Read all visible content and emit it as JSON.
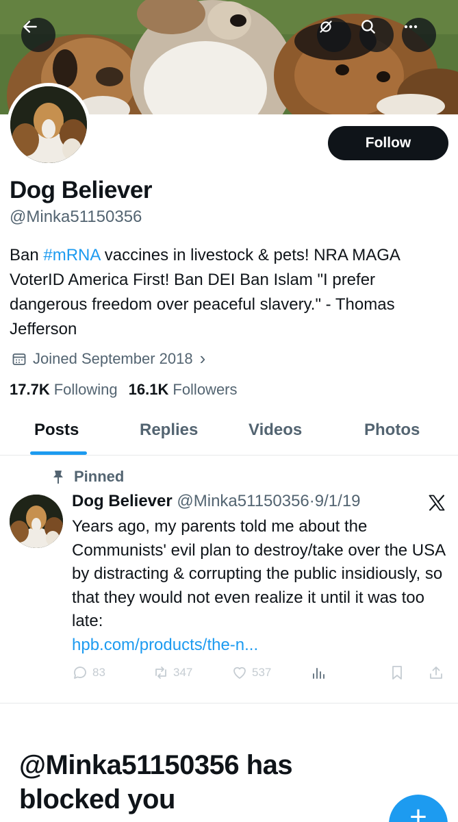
{
  "header": {
    "back_icon": "arrow-left-icon",
    "actions": [
      "no-notifications-icon",
      "search-icon",
      "more-icon"
    ]
  },
  "profile": {
    "display_name": "Dog Believer",
    "handle": "@Minka51150356",
    "follow_label": "Follow",
    "bio_prefix": "Ban ",
    "bio_hashtag": "#mRNA",
    "bio_suffix": " vaccines in livestock & pets! NRA MAGA VoterID America First! Ban DEI Ban Islam \"I prefer dangerous freedom over peaceful slavery.\" - Thomas Jefferson",
    "joined": "Joined September 2018",
    "following_count": "17.7K",
    "following_label": "Following",
    "followers_count": "16.1K",
    "followers_label": "Followers"
  },
  "tabs": [
    {
      "label": "Posts",
      "active": true
    },
    {
      "label": "Replies",
      "active": false
    },
    {
      "label": "Videos",
      "active": false
    },
    {
      "label": "Photos",
      "active": false
    }
  ],
  "pinned_post": {
    "pinned_label": "Pinned",
    "author_name": "Dog Believer",
    "author_handle": "@Minka51150356",
    "separator": "·",
    "date": "9/1/19",
    "text": "Years ago, my parents told me about the Communists' evil plan to  destroy/take over the USA by distracting & corrupting the public insidiously, so that they would not even realize it until it was too late:",
    "link": "hpb.com/products/the-n...",
    "replies": "83",
    "reposts": "347",
    "likes": "537"
  },
  "blocked_message": "@Minka51150356 has blocked you",
  "colors": {
    "accent": "#1d9bf0",
    "text": "#0f1419",
    "muted": "#536471"
  }
}
